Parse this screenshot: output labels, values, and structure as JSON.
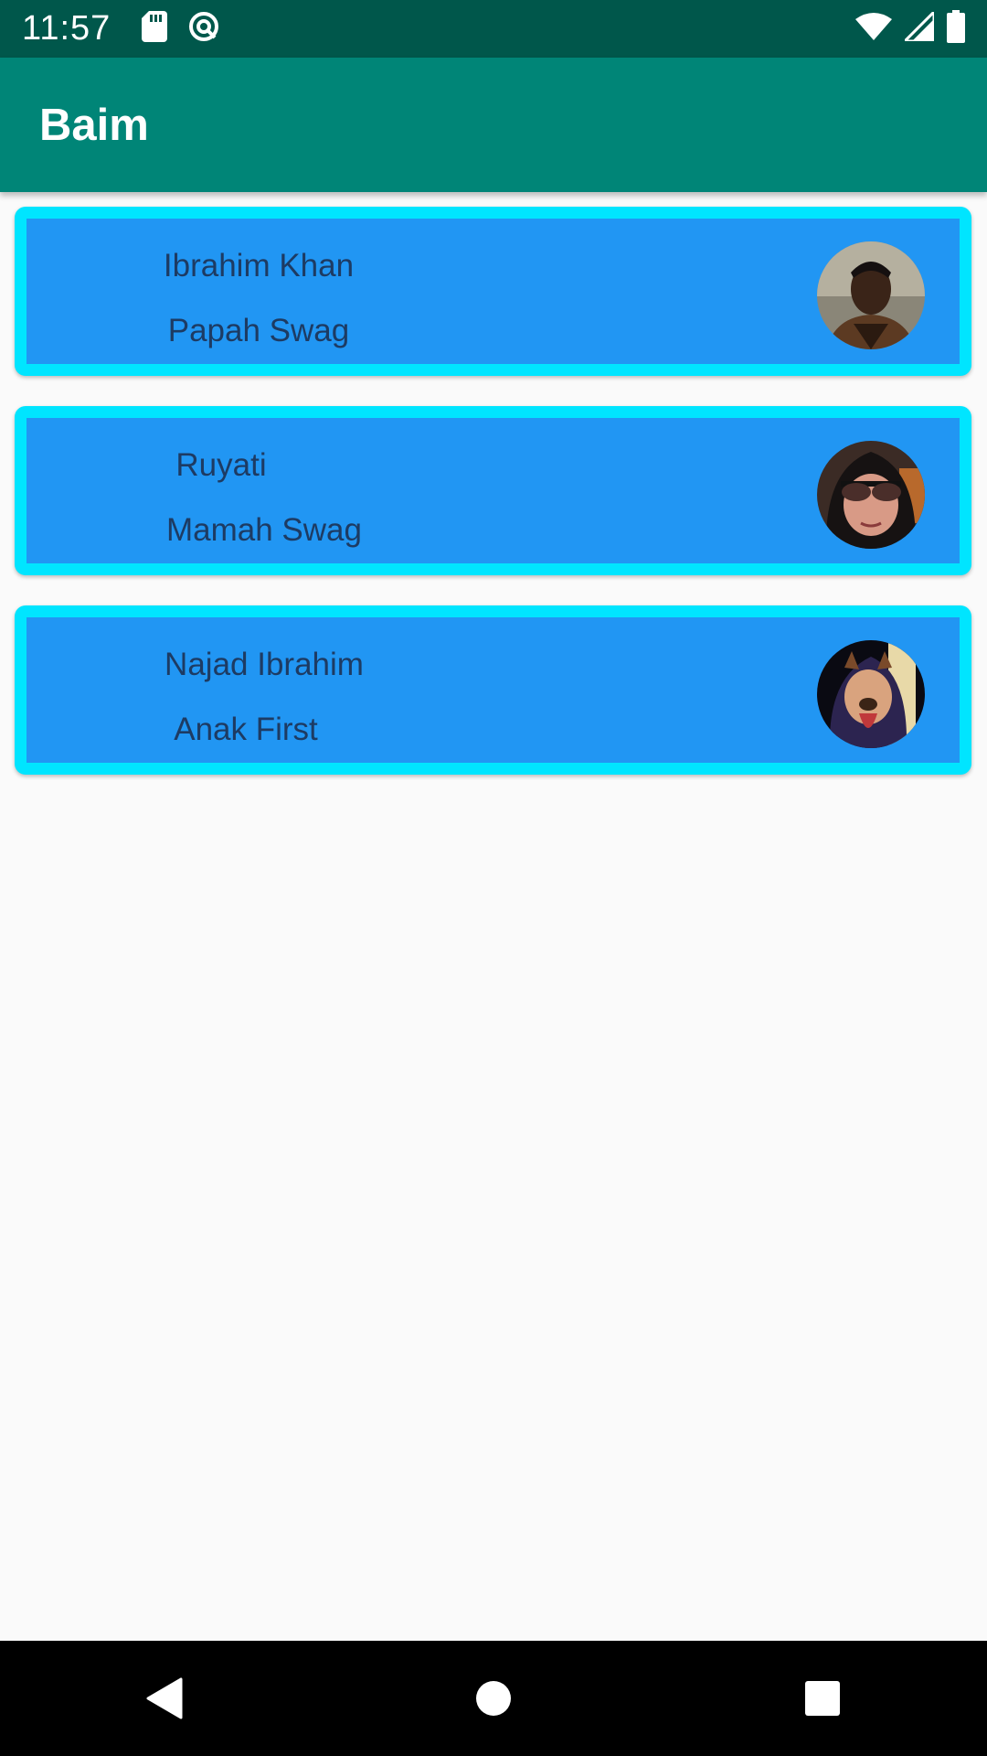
{
  "status_bar": {
    "time": "11:57",
    "left_icons": [
      "sd-card-icon",
      "data-saver-icon"
    ],
    "right_icons": [
      "wifi-icon",
      "cell-signal-icon",
      "battery-icon"
    ]
  },
  "app_bar": {
    "title": "Baim"
  },
  "contacts": [
    {
      "name": "Ibrahim Khan",
      "role": "Papah Swag",
      "avatar": "avatar-photo"
    },
    {
      "name": "Ruyati",
      "role": "Mamah Swag",
      "avatar": "avatar-photo"
    },
    {
      "name": "Najad Ibrahim",
      "role": "Anak First",
      "avatar": "avatar-photo"
    }
  ],
  "nav_bar": {
    "buttons": [
      "back-icon",
      "home-icon",
      "recents-icon"
    ]
  },
  "colors": {
    "status_bar": "#00574b",
    "app_bar": "#008577",
    "card_fill": "#2196f3",
    "card_border": "#00e5ff",
    "card_text": "#1d3b63"
  }
}
